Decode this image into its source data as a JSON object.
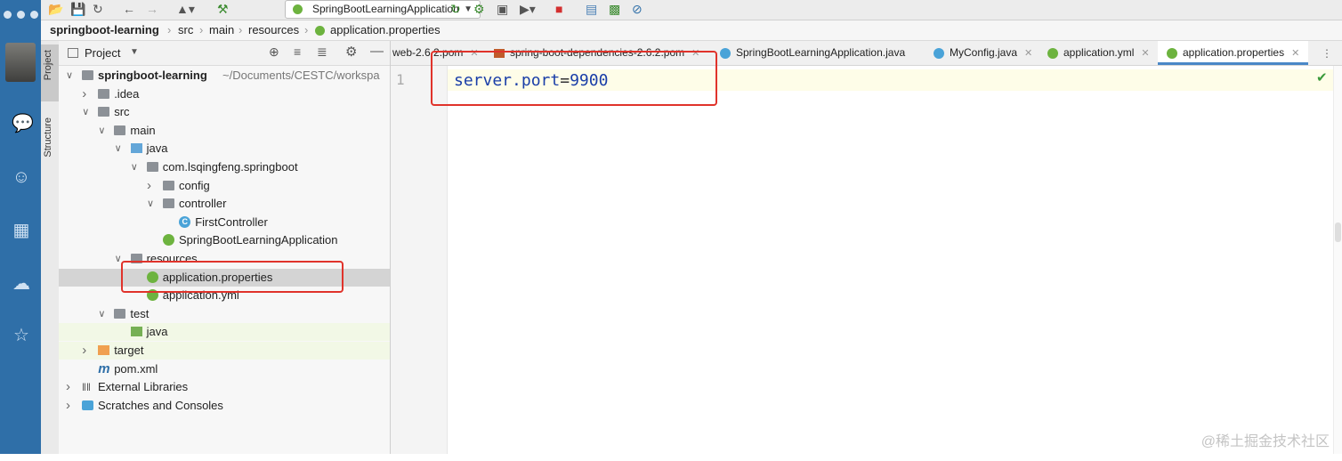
{
  "toolbar": {
    "run_config": "SpringBootLearningApplication"
  },
  "breadcrumb": [
    "springboot-learning",
    "src",
    "main",
    "resources",
    "application.properties"
  ],
  "side_tools": {
    "project": "Project",
    "structure": "Structure"
  },
  "project_panel": {
    "title": "Project",
    "tree": [
      {
        "label": "springboot-learning",
        "suffix": "~/Documents/CESTC/workspa",
        "depth": 0,
        "chevron": "down",
        "icon": "folder",
        "bold": true
      },
      {
        "label": ".idea",
        "depth": 1,
        "chevron": "right",
        "icon": "folder"
      },
      {
        "label": "src",
        "depth": 1,
        "chevron": "down",
        "icon": "folder"
      },
      {
        "label": "main",
        "depth": 2,
        "chevron": "down",
        "icon": "folder"
      },
      {
        "label": "java",
        "depth": 3,
        "chevron": "down",
        "icon": "folder-blue"
      },
      {
        "label": "com.lsqingfeng.springboot",
        "depth": 4,
        "chevron": "down",
        "icon": "folder"
      },
      {
        "label": "config",
        "depth": 5,
        "chevron": "right",
        "icon": "folder"
      },
      {
        "label": "controller",
        "depth": 5,
        "chevron": "down",
        "icon": "folder"
      },
      {
        "label": "FirstController",
        "depth": 6,
        "chevron": "",
        "icon": "class"
      },
      {
        "label": "SpringBootLearningApplication",
        "depth": 5,
        "chevron": "",
        "icon": "spring"
      },
      {
        "label": "resources",
        "depth": 3,
        "chevron": "down",
        "icon": "folder"
      },
      {
        "label": "application.properties",
        "depth": 4,
        "chevron": "",
        "icon": "spring",
        "selected": true
      },
      {
        "label": "application.yml",
        "depth": 4,
        "chevron": "",
        "icon": "spring"
      },
      {
        "label": "test",
        "depth": 2,
        "chevron": "down",
        "icon": "folder"
      },
      {
        "label": "java",
        "depth": 3,
        "chevron": "",
        "icon": "folder-green",
        "highlight": true
      },
      {
        "label": "target",
        "depth": 1,
        "chevron": "right",
        "icon": "folder-orange",
        "highlight": true
      },
      {
        "label": "pom.xml",
        "depth": 1,
        "chevron": "",
        "icon": "maven"
      },
      {
        "label": "External Libraries",
        "depth": 0,
        "chevron": "right",
        "icon": "libraries"
      },
      {
        "label": "Scratches and Consoles",
        "depth": 0,
        "chevron": "right",
        "icon": "scratches"
      }
    ]
  },
  "tabs": [
    {
      "label": "web-2.6.2.pom",
      "icon": "none"
    },
    {
      "label": "spring-boot-dependencies-2.6.2.pom",
      "icon": "maven"
    },
    {
      "label": "SpringBootLearningApplication.java",
      "icon": "spring"
    },
    {
      "label": "MyConfig.java",
      "icon": "class"
    },
    {
      "label": "application.yml",
      "icon": "spring"
    },
    {
      "label": "application.properties",
      "icon": "spring",
      "active": true
    }
  ],
  "editor": {
    "line_number": "1",
    "key": "server.port",
    "equals": "=",
    "value": "9900"
  },
  "watermark": "@稀土掘金技术社区"
}
